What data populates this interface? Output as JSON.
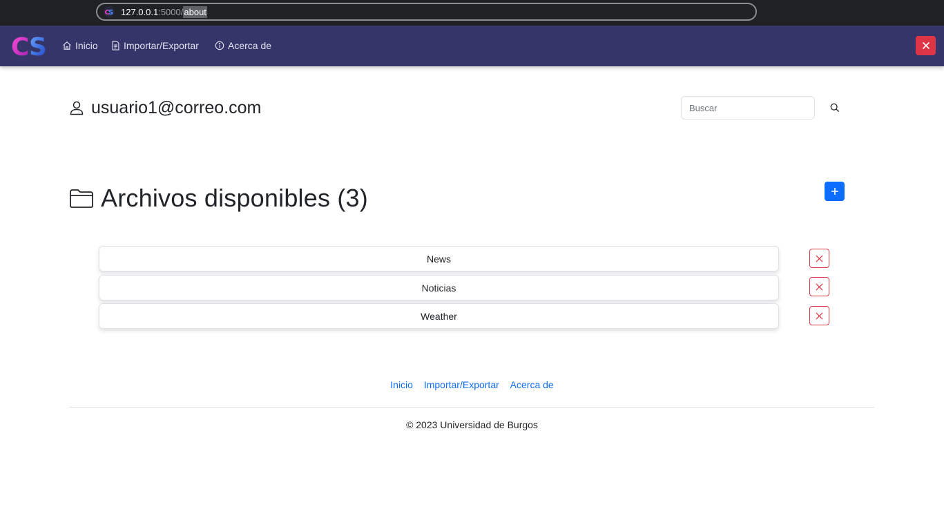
{
  "browser": {
    "url_host": "127.0.0.1",
    "url_port": ":5000/",
    "url_path": "about"
  },
  "navbar": {
    "logo_text": "CS",
    "links": [
      {
        "label": "Inicio",
        "icon": "home-icon"
      },
      {
        "label": "Importar/Exportar",
        "icon": "file-icon"
      },
      {
        "label": "Acerca de",
        "icon": "info-icon"
      }
    ],
    "close_icon": "close-icon"
  },
  "user": {
    "email": "usuario1@correo.com",
    "icon": "person-icon"
  },
  "search": {
    "placeholder": "Buscar",
    "icon": "search-icon"
  },
  "files": {
    "title": "Archivos disponibles (3)",
    "icon": "folder-icon",
    "add_icon": "plus-icon",
    "items": [
      {
        "name": "News"
      },
      {
        "name": "Noticias"
      },
      {
        "name": "Weather"
      }
    ]
  },
  "footer": {
    "links": [
      "Inicio",
      "Importar/Exportar",
      "Acerca de"
    ],
    "copyright": "© 2023 Universidad de Burgos"
  },
  "colors": {
    "navbar_bg": "#35356a",
    "danger": "#dc3545",
    "primary": "#0d6efd"
  }
}
